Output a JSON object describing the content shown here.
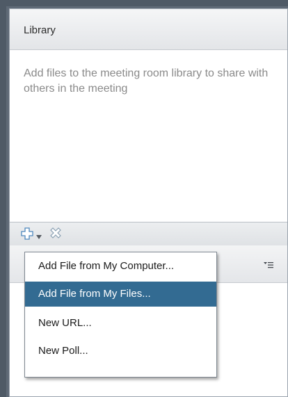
{
  "library": {
    "title": "Library",
    "description": "Add files to the meeting room library to share with others in the meeting"
  },
  "toolbar": {
    "add_icon": "plus-icon",
    "dropdown_icon": "caret-down-icon",
    "remove_icon": "remove-icon"
  },
  "menu": {
    "items": [
      {
        "label": "Add File from My Computer...",
        "selected": false
      },
      {
        "label": "Add File from My Files...",
        "selected": true
      },
      {
        "label": "New URL...",
        "selected": false
      },
      {
        "label": "New Poll...",
        "selected": false
      }
    ]
  },
  "colors": {
    "selection": "#336b92",
    "frame": "#4f5a66",
    "description_text": "#8a8a8a"
  }
}
